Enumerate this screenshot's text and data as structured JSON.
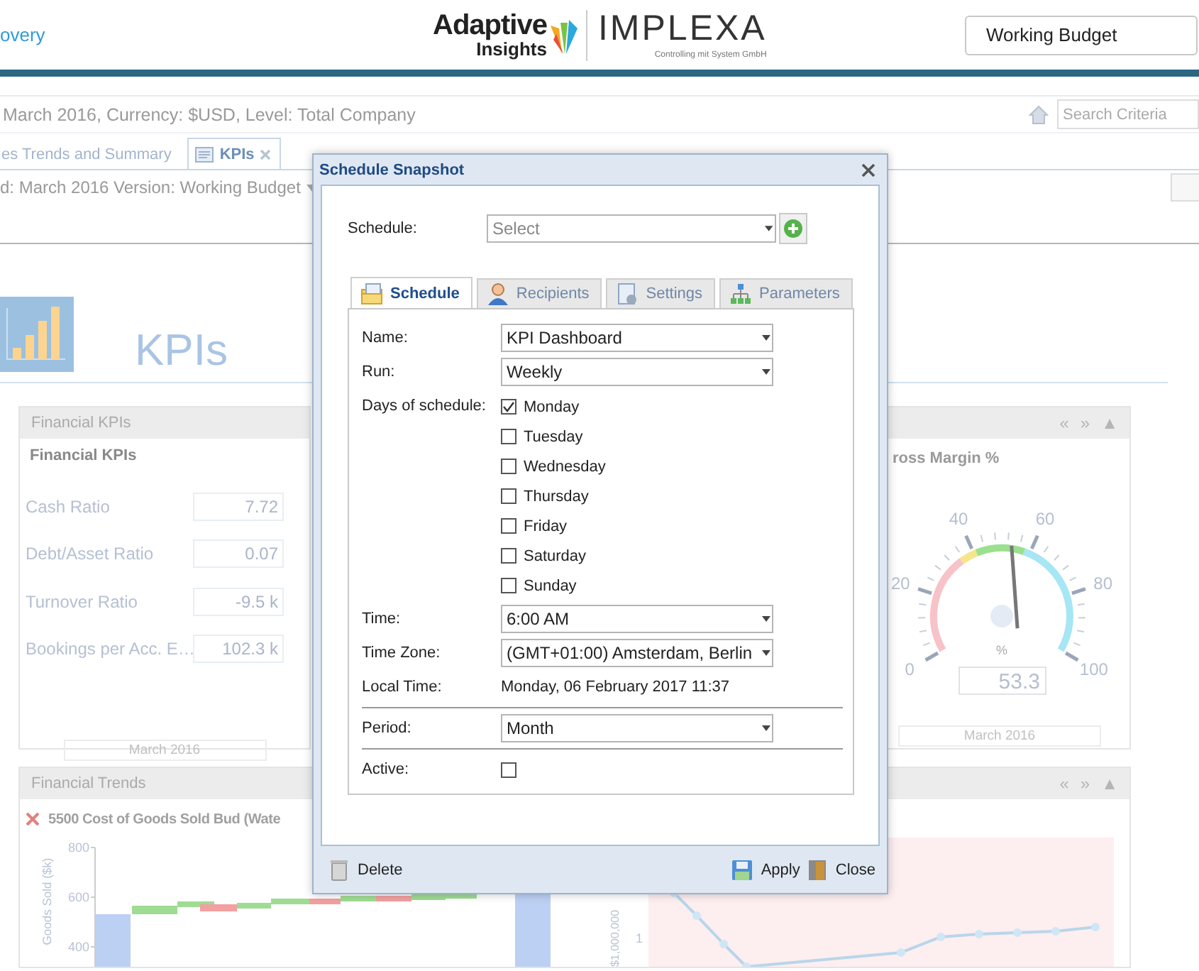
{
  "header": {
    "link": "overy",
    "logo": {
      "brand": "Adaptive",
      "sub": "Insights",
      "partner": "IMPLEXA",
      "tagline": "Controlling mit System GmbH"
    },
    "version_field": {
      "value": "Working Budget"
    }
  },
  "context_bar": {
    "text": "March 2016, Currency: $USD, Level: Total Company",
    "search": {
      "placeholder": "Search Criteria"
    }
  },
  "tabs": [
    {
      "label": "es Trends and Summary",
      "selected": false
    },
    {
      "label": "KPIs",
      "selected": true
    }
  ],
  "filter_bar": {
    "text": "d: March 2016 Version: Working Budget"
  },
  "page_title": "KPIs",
  "kpi_panel": {
    "header": "Financial KPIs",
    "title": "Financial KPIs",
    "rows": [
      {
        "label": "Cash Ratio",
        "value": "7.72"
      },
      {
        "label": "Debt/Asset Ratio",
        "value": "0.07"
      },
      {
        "label": "Turnover Ratio",
        "value": "-9.5 k"
      },
      {
        "label": "Bookings per Acc. E…",
        "value": "102.3 k"
      }
    ],
    "period": "March 2016"
  },
  "gauge_panel": {
    "controls": [
      "«",
      "»",
      "▲"
    ],
    "title": "ross Margin %",
    "gauge": {
      "ticks": [
        "0",
        "20",
        "40",
        "60",
        "80",
        "100"
      ],
      "unit": "%",
      "value": "53.3",
      "level": 0.533
    },
    "period": "March 2016"
  },
  "trends_panel": {
    "header": "Financial Trends",
    "controls": [
      "«",
      "»",
      "▲"
    ],
    "left_chart": {
      "title": "5500 Cost of Goods Sold Bud (Wate",
      "ylabel": "Goods Sold ($k)",
      "yticks": [
        "800",
        "600",
        "400"
      ]
    },
    "right_chart": {
      "ylabel": "$1,000,000",
      "ytick": "1"
    }
  },
  "dialog": {
    "title": "Schedule Snapshot",
    "schedule": {
      "label": "Schedule:",
      "placeholder": "Select"
    },
    "tabs": [
      {
        "label": "Schedule",
        "selected": true
      },
      {
        "label": "Recipients",
        "selected": false
      },
      {
        "label": "Settings",
        "selected": false
      },
      {
        "label": "Parameters",
        "selected": false
      }
    ],
    "fields": [
      {
        "kind": "combo",
        "label": "Name:",
        "value": "KPI Dashboard"
      },
      {
        "kind": "combo",
        "label": "Run:",
        "value": "Weekly"
      },
      {
        "kind": "days",
        "label": "Days of schedule:",
        "days": [
          {
            "label": "Monday",
            "checked": true
          },
          {
            "label": "Tuesday",
            "checked": false
          },
          {
            "label": "Wednesday",
            "checked": false
          },
          {
            "label": "Thursday",
            "checked": false
          },
          {
            "label": "Friday",
            "checked": false
          },
          {
            "label": "Saturday",
            "checked": false
          },
          {
            "label": "Sunday",
            "checked": false
          }
        ]
      },
      {
        "kind": "combo",
        "label": "Time:",
        "value": "6:00 AM"
      },
      {
        "kind": "combo",
        "label": "Time Zone:",
        "value": "(GMT+01:00) Amsterdam, Berlin"
      },
      {
        "kind": "text",
        "label": "Local Time:",
        "value": "Monday, 06 February 2017 11:37"
      },
      {
        "kind": "combo",
        "label": "Period:",
        "value": "Month",
        "separated": true
      },
      {
        "kind": "check",
        "label": "Active:",
        "checked": false,
        "separated": true
      }
    ],
    "buttons": [
      {
        "label": "Delete"
      },
      {
        "label": "Apply"
      },
      {
        "label": "Close"
      }
    ]
  }
}
